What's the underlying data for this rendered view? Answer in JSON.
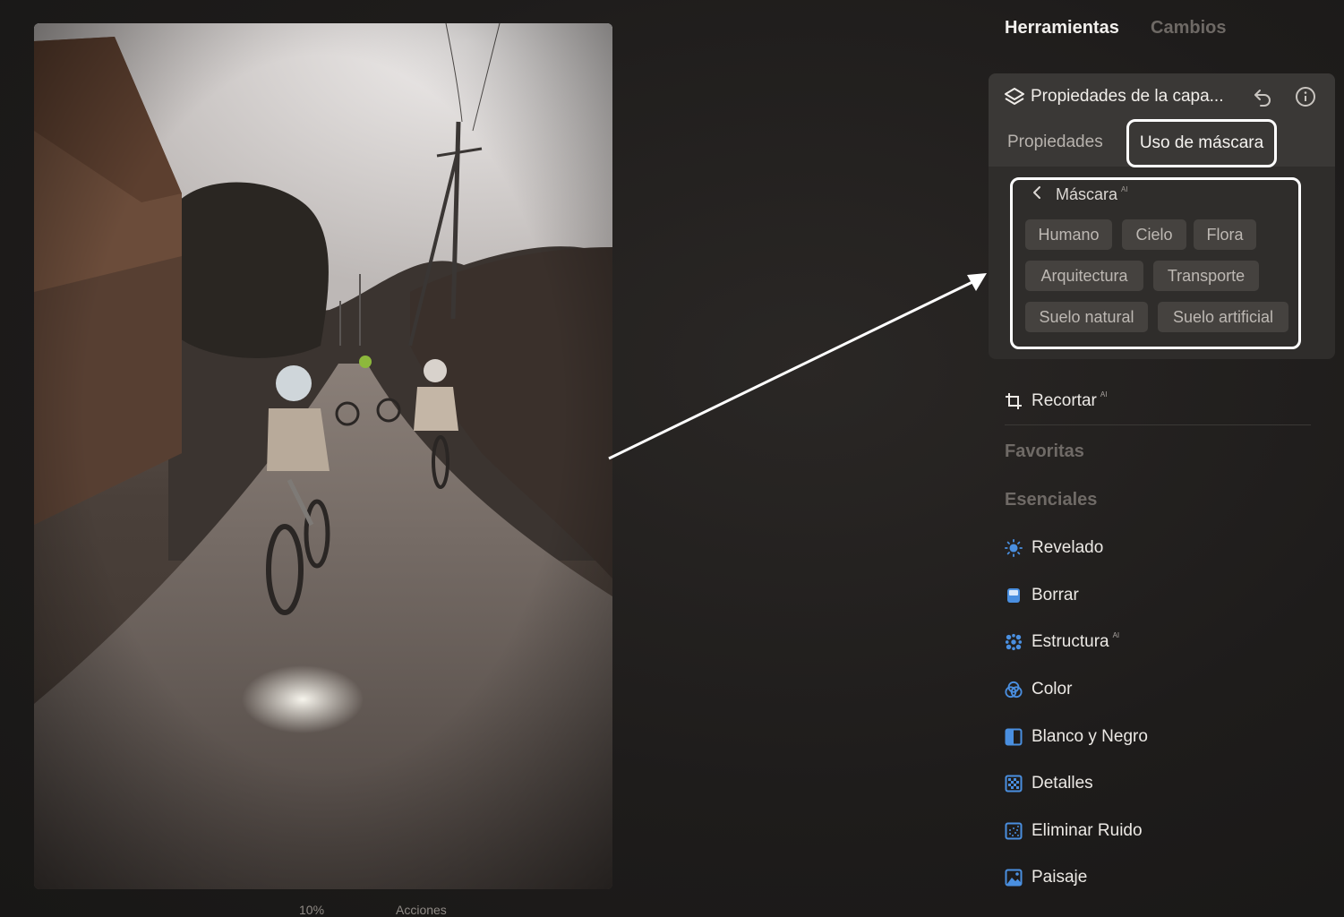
{
  "top_tabs": {
    "active": "Herramientas",
    "inactive": "Cambios"
  },
  "layer_panel": {
    "title": "Propiedades de la capa...",
    "subtabs": {
      "properties": "Propiedades",
      "mask_use": "Uso de máscara"
    },
    "mask": {
      "title": "Máscara",
      "ai_badge": "AI",
      "chips": [
        "Humano",
        "Cielo",
        "Flora",
        "Arquitectura",
        "Transporte",
        "Suelo natural",
        "Suelo artificial"
      ]
    }
  },
  "crop": {
    "label": "Recortar",
    "ai_badge": "AI"
  },
  "sections": {
    "favorites": "Favoritas",
    "essentials": "Esenciales"
  },
  "tools": [
    {
      "label": "Revelado",
      "icon": "sun-icon",
      "ai": ""
    },
    {
      "label": "Borrar",
      "icon": "eraser-icon",
      "ai": ""
    },
    {
      "label": "Estructura",
      "icon": "dots-grid-icon",
      "ai": "AI"
    },
    {
      "label": "Color",
      "icon": "color-circles-icon",
      "ai": ""
    },
    {
      "label": "Blanco y Negro",
      "icon": "half-square-icon",
      "ai": ""
    },
    {
      "label": "Detalles",
      "icon": "checker-square-icon",
      "ai": ""
    },
    {
      "label": "Eliminar Ruido",
      "icon": "grain-square-icon",
      "ai": ""
    },
    {
      "label": "Paisaje",
      "icon": "landscape-icon",
      "ai": ""
    }
  ],
  "bottom_bar": {
    "zoom": "10%",
    "actions": "Acciones"
  },
  "colors": {
    "accent_icon": "#4a8fe0",
    "outline": "#ffffff"
  }
}
